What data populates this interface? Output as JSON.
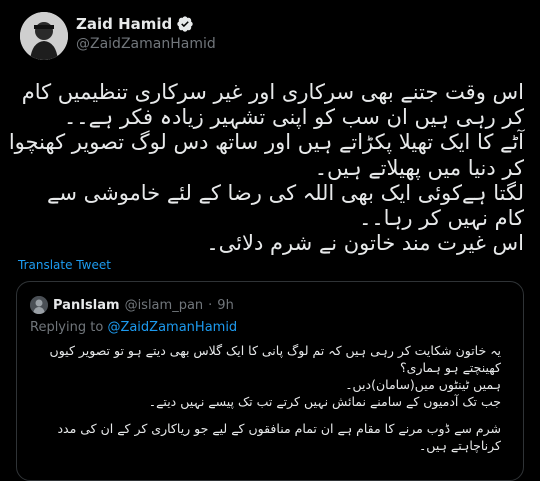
{
  "author": {
    "name": "Zaid Hamid",
    "handle": "@ZaidZamanHamid",
    "verified": true
  },
  "tweet": {
    "lines": [
      "اس وقت جتنے بھی سرکاری اور غیر سرکاری تنظیمیں کام",
      "کر رہی ہیں ان سب کو اپنی تشہیر زیادہ فکر ہے۔۔",
      "آٹے کا ایک تھیلا پکڑاتے ہیں اور ساتھ دس لوگ تصویر کھنچوا",
      "کر دنیا میں پھیلاتے ہیں۔",
      " لگتا ہےکوئی ایک بھی اللہ کی رضا کے لئے خاموشی سے",
      "کام نہیں کر رہا۔۔",
      "اس غیرت مند خاتون نے شرم دلائی۔"
    ],
    "translate_label": "Translate Tweet"
  },
  "quoted": {
    "name": "PanIslam",
    "handle": "@islam_pan",
    "separator": "·",
    "time": "9h",
    "replying_prefix": "Replying to ",
    "replying_to": "@ZaidZamanHamid",
    "lines": [
      "یہ خاتون شکایت کر رہی ہیں کہ تم لوگ پانی کا ایک گلاس بھی دیتے ہو تو تصویر کیوں",
      "کھینچتے ہو ہماری؟",
      "ہمیں ٹینٹوں میں(سامان)دیں۔",
      "جب تک آدمیوں کے سامنے نمائش نہیں کرتے تب تک پیسے نہیں دیتے۔",
      "",
      "شرم سے ڈوب مرنے کا مقام ہے ان تمام منافقوں کے لیے جو ریاکاری کر کے ان کی مدد",
      "کرناچاہتے ہیں۔"
    ]
  },
  "colors": {
    "background": "#000000",
    "text": "#e7e9ea",
    "muted": "#71767b",
    "accent": "#1d9bf0",
    "border": "#2f3336"
  }
}
